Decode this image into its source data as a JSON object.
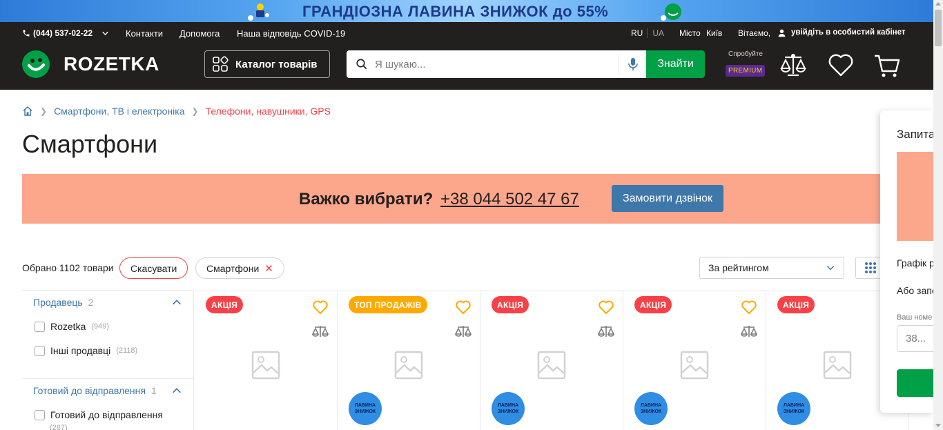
{
  "promo": {
    "text": "ГРАНДІОЗНА ЛАВИНА ЗНИЖОК до 55%"
  },
  "topbar": {
    "phone": "(044) 537-02-22",
    "links": [
      "Контакти",
      "Допомога",
      "Наша відповідь COVID-19"
    ],
    "lang_ru": "RU",
    "lang_ua": "UA",
    "city_label": "Місто",
    "city": "Київ",
    "greeting": "Вітаємо,",
    "login": "увійдіть в особистий кабінет"
  },
  "header": {
    "logo": "ROZETKA",
    "catalog": "Каталог товарів",
    "search_placeholder": "Я шукаю...",
    "search_button": "Знайти",
    "try_label": "Спробуйте",
    "premium": "PREMIUM"
  },
  "breadcrumbs": [
    "Смартфони, ТВ і електроніка",
    "Телефони, навушники, GPS"
  ],
  "page_title": "Смартфони",
  "callbar": {
    "question": "Важко вибрати?",
    "phone": "+38 044 502 47 67",
    "button": "Замовити дзвінок"
  },
  "filters_bar": {
    "selected": "Обрано 1102 товари",
    "cancel": "Скасувати",
    "chip": "Смартфони",
    "sort": "За рейтингом"
  },
  "sidebar": {
    "seller": {
      "title": "Продавець",
      "count": "2",
      "options": [
        {
          "label": "Rozetka",
          "num": "(949)"
        },
        {
          "label": "Інші продавці",
          "num": "(2118)"
        }
      ]
    },
    "ready": {
      "title": "Готовий до відправлення",
      "count": "1",
      "options": [
        {
          "label": "Готовий до відправлення",
          "num": "(287)"
        }
      ]
    }
  },
  "tiles": [
    {
      "badge": "АКЦІЯ",
      "badge_color": "#f84147",
      "lavina": false
    },
    {
      "badge": "ТОП ПРОДАЖІВ",
      "badge_color": "#ffa900",
      "lavina": true
    },
    {
      "badge": "АКЦІЯ",
      "badge_color": "#f84147",
      "lavina": true
    },
    {
      "badge": "АКЦІЯ",
      "badge_color": "#f84147",
      "lavina": true
    },
    {
      "badge": "АКЦІЯ",
      "badge_color": "#f84147",
      "lavina": true
    }
  ],
  "lavina_text": "ЛАВИНА ЗНИЖОК",
  "panel": {
    "title": "Запита",
    "schedule": "Графік р",
    "or": "Або запо",
    "label": "Ваш номе",
    "input_placeholder": "38..."
  },
  "colors": {
    "header": "#221f1f",
    "green": "#00a046",
    "red": "#f84147",
    "blue": "#3e77aa",
    "salmon": "#fca78c"
  }
}
